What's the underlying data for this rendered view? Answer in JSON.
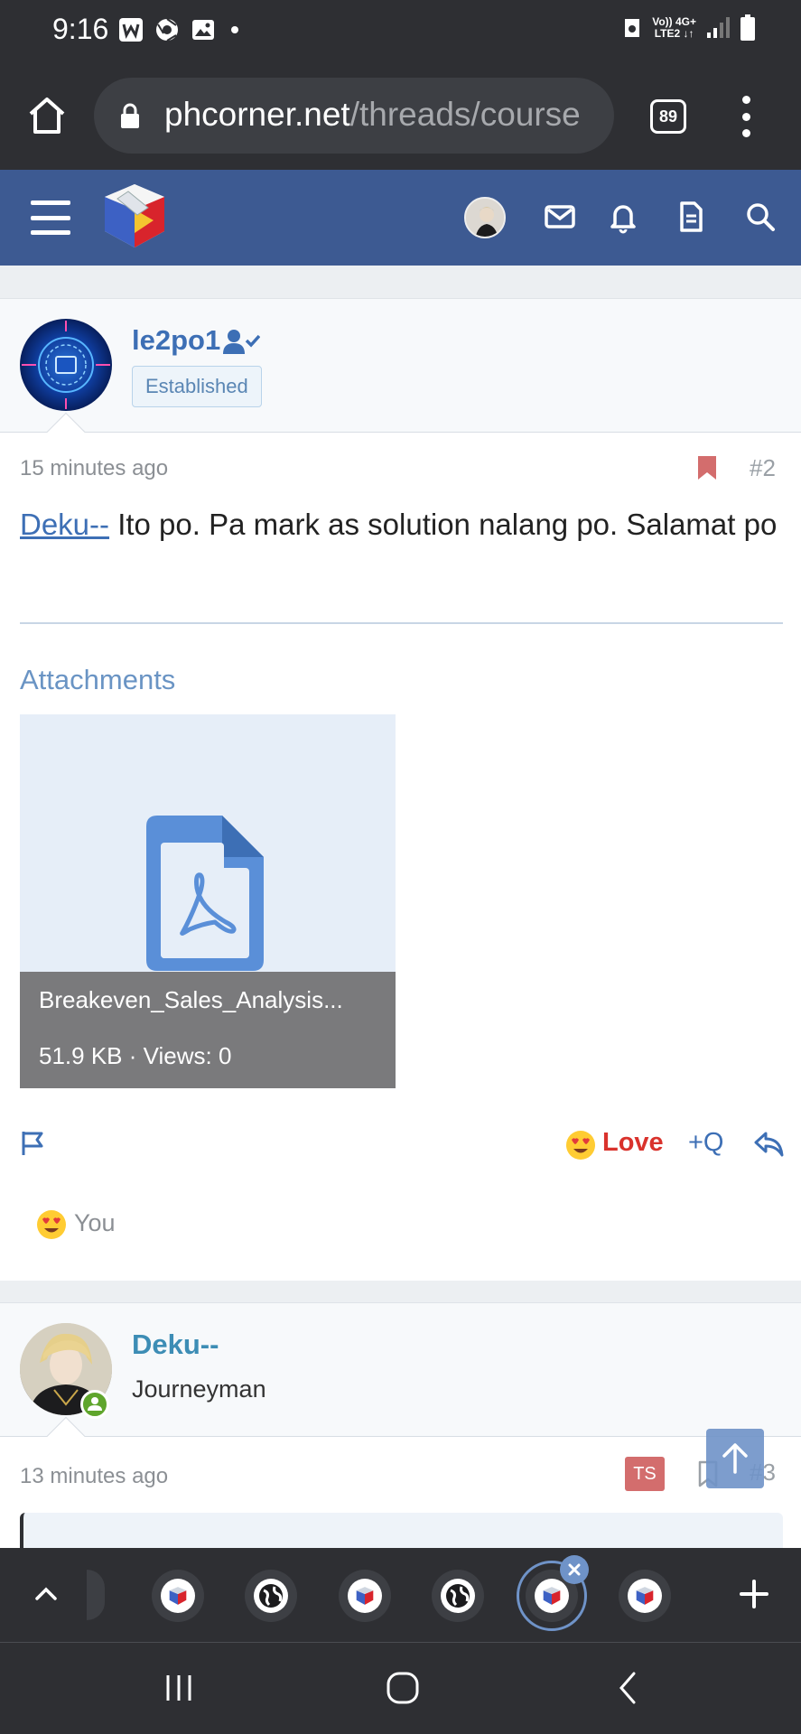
{
  "status_bar": {
    "time": "9:16",
    "network_top": "Vo)) 4G+",
    "network_bottom": "LTE2 ↓↑"
  },
  "browser": {
    "url_domain": "phcorner.net",
    "url_path": "/threads/course",
    "tab_count": "89"
  },
  "post1": {
    "username": "le2po1",
    "user_badge": "Established",
    "time": "15 minutes ago",
    "number": "#2",
    "mention": "Deku--",
    "body_text": " Ito po. Pa mark as solution nalang po. Salamat po",
    "attachments_title": "Attachments",
    "attachment": {
      "filename": "Breakeven_Sales_Analysis...",
      "info": "51.9 KB · Views: 0"
    },
    "love_label": "Love",
    "quote_label": "+Q",
    "reacted_by": "You"
  },
  "post2": {
    "username": "Deku--",
    "user_title": "Journeyman",
    "time": "13 minutes ago",
    "ts_badge": "TS",
    "number": "#3"
  },
  "colors": {
    "header_blue": "#3d5a92",
    "link_blue": "#3d6fb5",
    "love_red": "#d9322c",
    "bookmark_red": "#d36d6d",
    "dark_chrome": "#2e2f33"
  },
  "icons": {
    "home": "home-icon",
    "lock": "lock-icon",
    "menu": "more-vert-icon",
    "hamburger": "hamburger-icon",
    "mail": "mail-icon",
    "bell": "bell-icon",
    "document": "document-icon",
    "search": "search-icon",
    "bookmark": "bookmark-icon",
    "pdf": "pdf-icon",
    "flag": "flag-icon",
    "reply": "reply-icon"
  }
}
